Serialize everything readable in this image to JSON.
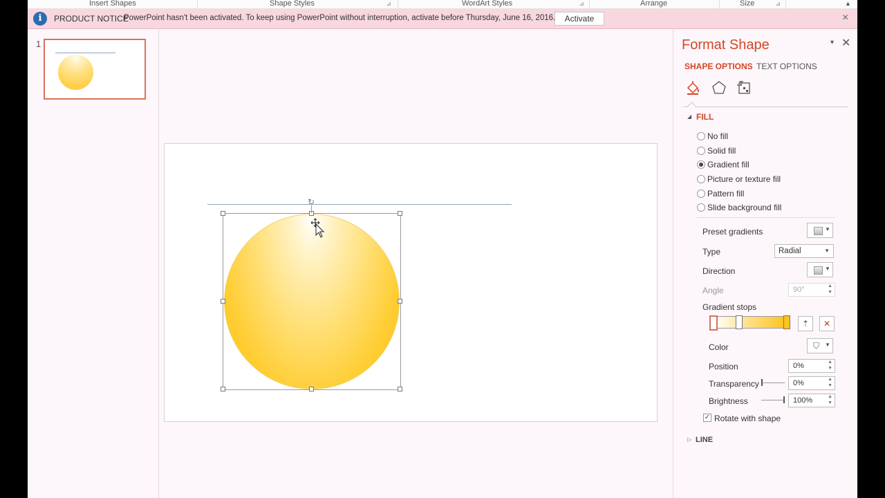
{
  "ribbon": {
    "groups": [
      {
        "label": "Insert Shapes"
      },
      {
        "label": "Shape Styles"
      },
      {
        "label": "WordArt Styles"
      },
      {
        "label": "Arrange"
      },
      {
        "label": "Size"
      }
    ]
  },
  "notice": {
    "title": "PRODUCT NOTICE",
    "message": "PowerPoint hasn't been activated. To keep using PowerPoint without interruption, activate before Thursday, June 16, 2016.",
    "activate_label": "Activate",
    "close_label": "×"
  },
  "thumbnails": {
    "slide_number": "1"
  },
  "format_pane": {
    "title": "Format Shape",
    "close_label": "✕",
    "menu_label": "▾",
    "tabs": {
      "shape_options": "SHAPE OPTIONS",
      "text_options": "TEXT OPTIONS"
    },
    "category_icons": [
      "fill-line-icon",
      "effects-icon",
      "size-properties-icon"
    ],
    "fill_section": {
      "heading": "FILL",
      "options": [
        {
          "label": "No fill",
          "checked": false
        },
        {
          "label": "Solid fill",
          "checked": false
        },
        {
          "label": "Gradient fill",
          "checked": true
        },
        {
          "label": "Picture or texture fill",
          "checked": false
        },
        {
          "label": "Pattern fill",
          "checked": false
        },
        {
          "label": "Slide background fill",
          "checked": false
        }
      ],
      "preset_gradients_label": "Preset gradients",
      "type_label": "Type",
      "type_value": "Radial",
      "direction_label": "Direction",
      "angle_label": "Angle",
      "angle_value": "90°",
      "gradient_stops_label": "Gradient stops",
      "color_label": "Color",
      "position_label": "Position",
      "position_value": "0%",
      "transparency_label": "Transparency",
      "transparency_value": "0%",
      "brightness_label": "Brightness",
      "brightness_value": "100%",
      "rotate_with_shape_label": "Rotate with shape",
      "rotate_with_shape_checked": true
    },
    "line_section": {
      "heading": "LINE"
    }
  },
  "colors": {
    "accent": "#d24726",
    "notice_bg": "#f8d7de",
    "shape_fill_center": "#ffffff",
    "shape_fill_edge": "#ffbe18"
  }
}
